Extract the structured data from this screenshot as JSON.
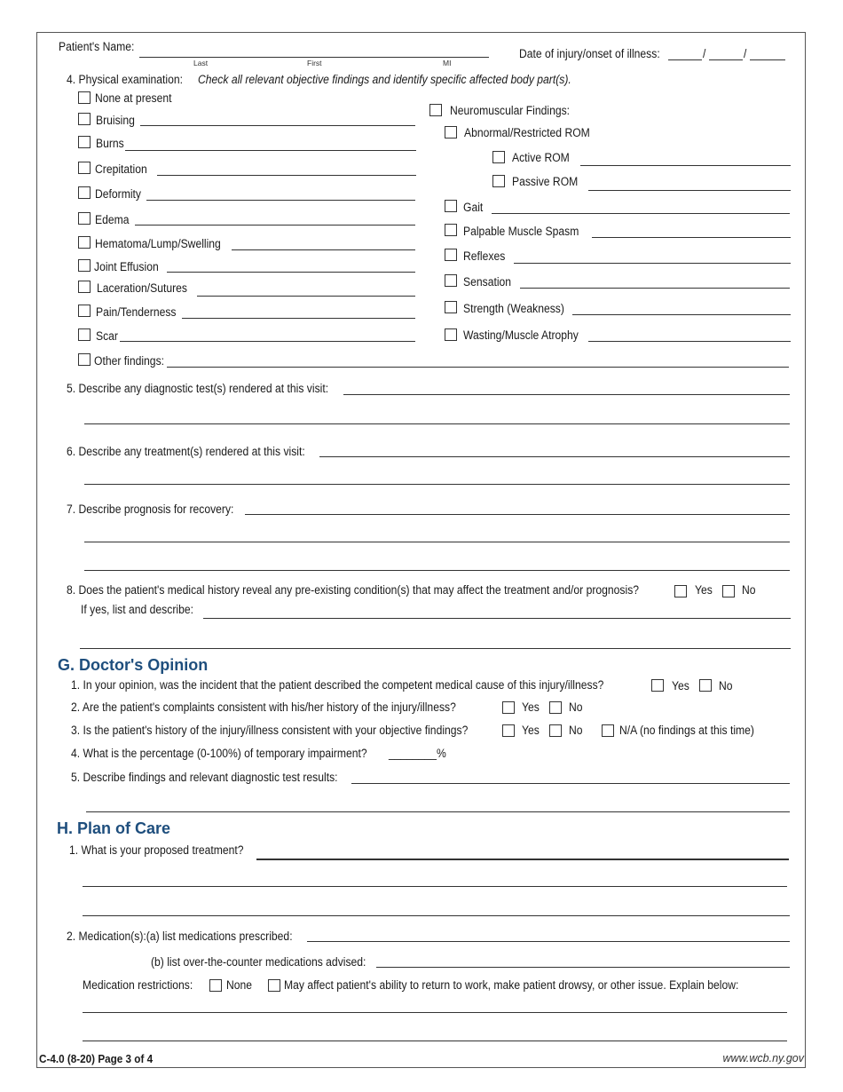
{
  "header": {
    "patient_name_label": "Patient's Name:",
    "name_sublabels": {
      "last": "Last",
      "first": "First",
      "mi": "MI"
    },
    "date_label": "Date of injury/onset of illness:",
    "date_separators": "/"
  },
  "physical_exam": {
    "title": "4. Physical examination:",
    "instruction": "Check all relevant objective findings and identify specific affected body part(s).",
    "none_label": "None at present",
    "left_items": [
      "Bruising",
      "Burns",
      "Crepitation",
      "Deformity",
      "Edema",
      "Hematoma/Lump/Swelling",
      "Joint Effusion",
      "Laceration/Sutures",
      "Pain/Tenderness",
      "Scar"
    ],
    "neuro_label": "Neuromuscular Findings:",
    "abnormal_rom_label": "Abnormal/Restricted ROM",
    "active_rom_label": "Active ROM",
    "passive_rom_label": "Passive ROM",
    "right_items": [
      "Gait",
      "Palpable Muscle Spasm",
      "Reflexes",
      "Sensation",
      "Strength (Weakness)",
      "Wasting/Muscle Atrophy"
    ],
    "other_label": "Other findings:"
  },
  "questions": {
    "q5": "5. Describe any diagnostic test(s) rendered at this visit:",
    "q6": "6. Describe any treatment(s) rendered at this visit:",
    "q7": "7. Describe prognosis for recovery:",
    "q8": "8. Does the patient's medical history reveal any pre-existing condition(s) that may affect the treatment and/or prognosis?",
    "q8_followup": "If yes, list and describe:",
    "yes": "Yes",
    "no": "No"
  },
  "section_g": {
    "heading": "G. Doctor's Opinion",
    "q1": "1. In your opinion, was the incident that the patient described the competent medical cause of this injury/illness?",
    "q2": "2. Are the patient's complaints consistent with his/her history of the injury/illness?",
    "q3": "3. Is the patient's history of the injury/illness consistent with your objective findings?",
    "q3_na": "N/A (no findings at this time)",
    "q4": "4. What is the percentage (0-100%) of temporary impairment?",
    "q4_suffix": "________%",
    "q5": "5. Describe findings and relevant diagnostic test results:",
    "yes": "Yes",
    "no": "No"
  },
  "section_h": {
    "heading": "H. Plan of Care",
    "q1": "1. What is your proposed treatment?",
    "q2a": "2. Medication(s):(a) list medications prescribed:",
    "q2b": "(b) list over-the-counter medications advised:",
    "restrictions_label": "Medication restrictions:",
    "restriction_none": "None",
    "restriction_affect": "May affect patient's ability to return to work, make patient drowsy, or other issue.  Explain below:"
  },
  "footer": {
    "form_id": "C-4.0 (8-20)  Page 3 of 4",
    "website": "www.wcb.ny.gov"
  }
}
